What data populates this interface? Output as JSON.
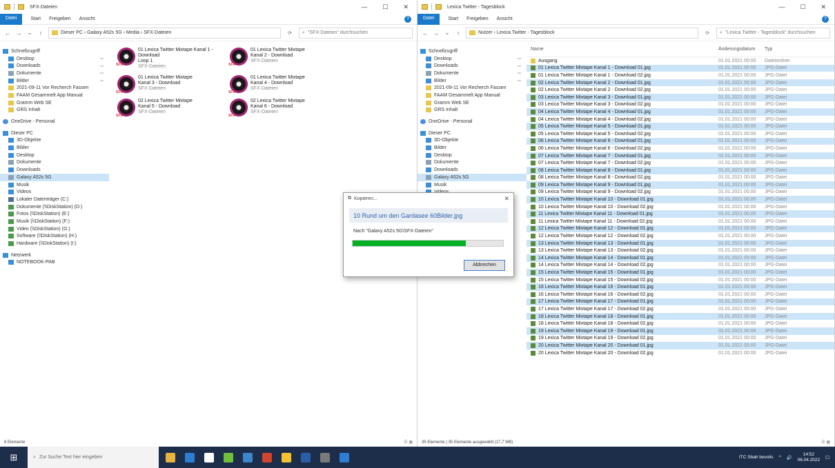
{
  "left": {
    "title": "SFX-Dateien",
    "ribbon_tabs": [
      "Datei",
      "Start",
      "Freigeben",
      "Ansicht"
    ],
    "address": "Dieser PC  ›  Galaxy A52s 5G  ›  Media  ›  SFX-Dateien",
    "search_placeholder": "\"SFX-Dateien\" durchsuchen",
    "status": "6 Elemente",
    "tiles": [
      {
        "name": "01 Lexica Twitter Mixtape Kanal 1 - Download",
        "name2": "Loop 1",
        "type": "SFX-Dateien"
      },
      {
        "name": "01 Lexica Twitter Mixtape",
        "name2": "Kanal 2 - Download",
        "type": "SFX-Dateien"
      },
      {
        "name": "01 Lexica Twitter Mixtape",
        "name2": "Kanal 3 - Download",
        "type": "SFX-Dateien"
      },
      {
        "name": "01 Lexica Twitter Mixtape",
        "name2": "Kanal 4 - Download",
        "type": "SFX-Dateien"
      },
      {
        "name": "02 Lexica Twitter Mixtape",
        "name2": "Kanal 5 - Download",
        "type": "SFX-Dateien"
      },
      {
        "name": "02 Lexica Twitter Mixtape",
        "name2": "Kanal 6 - Download",
        "type": "SFX-Dateien"
      }
    ]
  },
  "right": {
    "title": "Lexica Twitter - Tagesblock",
    "ribbon_tabs": [
      "Datei",
      "Start",
      "Freigeben",
      "Ansicht"
    ],
    "address": "Nutzer  ›  Lexica Twitter - Tagesblock",
    "search_placeholder": "\"Lexica Twitter - Tagesblock\" durchsuchen",
    "status": "35 Elemente  |  35 Elemente ausgewählt (17,7 MB)",
    "col_name": "Name",
    "col_date": "Änderungsdatum",
    "col_type": "Typ",
    "rows": [
      {
        "name": "Ausgang",
        "date": "01.01.2021 00:00",
        "type": "Dateiordner",
        "folder": true,
        "sel": false
      },
      {
        "name": "01 Lexica Twitter Mixtape Kanal 1 - Download 01.jpg",
        "date": "01.01.2021 00:00",
        "type": "JPG-Datei",
        "sel": true
      },
      {
        "name": "01 Lexica Twitter Mixtape Kanal 1 - Download 02.jpg",
        "date": "01.01.2021 00:00",
        "type": "JPG-Datei",
        "sel": false
      },
      {
        "name": "02 Lexica Twitter Mixtape Kanal 2 - Download 01.jpg",
        "date": "01.01.2021 00:00",
        "type": "JPG-Datei",
        "sel": true
      },
      {
        "name": "02 Lexica Twitter Mixtape Kanal 2 - Download 02.jpg",
        "date": "01.01.2021 00:00",
        "type": "JPG-Datei",
        "sel": false
      },
      {
        "name": "03 Lexica Twitter Mixtape Kanal 3 - Download 01.jpg",
        "date": "01.01.2021 00:00",
        "type": "JPG-Datei",
        "sel": true
      },
      {
        "name": "03 Lexica Twitter Mixtape Kanal 3 - Download 02.jpg",
        "date": "01.01.2021 00:00",
        "type": "JPG-Datei",
        "sel": false
      },
      {
        "name": "04 Lexica Twitter Mixtape Kanal 4 - Download 01.jpg",
        "date": "01.01.2021 00:00",
        "type": "JPG-Datei",
        "sel": true
      },
      {
        "name": "04 Lexica Twitter Mixtape Kanal 4 - Download 02.jpg",
        "date": "01.01.2021 00:00",
        "type": "JPG-Datei",
        "sel": false
      },
      {
        "name": "05 Lexica Twitter Mixtape Kanal 5 - Download 01.jpg",
        "date": "01.01.2021 00:00",
        "type": "JPG-Datei",
        "sel": true
      },
      {
        "name": "05 Lexica Twitter Mixtape Kanal 5 - Download 02.jpg",
        "date": "01.01.2021 00:00",
        "type": "JPG-Datei",
        "sel": false
      },
      {
        "name": "06 Lexica Twitter Mixtape Kanal 6 - Download 01.jpg",
        "date": "01.01.2021 00:00",
        "type": "JPG-Datei",
        "sel": true
      },
      {
        "name": "06 Lexica Twitter Mixtape Kanal 6 - Download 02.jpg",
        "date": "01.01.2021 00:00",
        "type": "JPG-Datei",
        "sel": false
      },
      {
        "name": "07 Lexica Twitter Mixtape Kanal 7 - Download 01.jpg",
        "date": "01.01.2021 00:00",
        "type": "JPG-Datei",
        "sel": true
      },
      {
        "name": "07 Lexica Twitter Mixtape Kanal 7 - Download 02.jpg",
        "date": "01.01.2021 00:00",
        "type": "JPG-Datei",
        "sel": false
      },
      {
        "name": "08 Lexica Twitter Mixtape Kanal 8 - Download 01.jpg",
        "date": "01.01.2021 00:00",
        "type": "JPG-Datei",
        "sel": true
      },
      {
        "name": "08 Lexica Twitter Mixtape Kanal 8 - Download 02.jpg",
        "date": "01.01.2021 00:00",
        "type": "JPG-Datei",
        "sel": false
      },
      {
        "name": "09 Lexica Twitter Mixtape Kanal 9 - Download 01.jpg",
        "date": "01.01.2021 00:00",
        "type": "JPG-Datei",
        "sel": true
      },
      {
        "name": "09 Lexica Twitter Mixtape Kanal 9 - Download 02.jpg",
        "date": "01.01.2021 00:00",
        "type": "JPG-Datei",
        "sel": false
      },
      {
        "name": "10 Lexica Twitter Mixtape Kanal 10 - Download 01.jpg",
        "date": "01.01.2021 00:00",
        "type": "JPG-Datei",
        "sel": true
      },
      {
        "name": "10 Lexica Twitter Mixtape Kanal 10 - Download 02.jpg",
        "date": "01.01.2021 00:00",
        "type": "JPG-Datei",
        "sel": false
      },
      {
        "name": "11 Lexica Twitter Mixtape Kanal 11 - Download 01.jpg",
        "date": "01.01.2021 00:00",
        "type": "JPG-Datei",
        "sel": true
      },
      {
        "name": "11 Lexica Twitter Mixtape Kanal 11 - Download 02.jpg",
        "date": "01.01.2021 00:00",
        "type": "JPG-Datei",
        "sel": false
      },
      {
        "name": "12 Lexica Twitter Mixtape Kanal 12 - Download 01.jpg",
        "date": "01.01.2021 00:00",
        "type": "JPG-Datei",
        "sel": true
      },
      {
        "name": "12 Lexica Twitter Mixtape Kanal 12 - Download 02.jpg",
        "date": "01.01.2021 00:00",
        "type": "JPG-Datei",
        "sel": false
      },
      {
        "name": "13 Lexica Twitter Mixtape Kanal 13 - Download 01.jpg",
        "date": "01.01.2021 00:00",
        "type": "JPG-Datei",
        "sel": true
      },
      {
        "name": "13 Lexica Twitter Mixtape Kanal 13 - Download 02.jpg",
        "date": "01.01.2021 00:00",
        "type": "JPG-Datei",
        "sel": false
      },
      {
        "name": "14 Lexica Twitter Mixtape Kanal 14 - Download 01.jpg",
        "date": "01.01.2021 00:00",
        "type": "JPG-Datei",
        "sel": true
      },
      {
        "name": "14 Lexica Twitter Mixtape Kanal 14 - Download 02.jpg",
        "date": "01.01.2021 00:00",
        "type": "JPG-Datei",
        "sel": false
      },
      {
        "name": "15 Lexica Twitter Mixtape Kanal 15 - Download 01.jpg",
        "date": "01.01.2021 00:00",
        "type": "JPG-Datei",
        "sel": true
      },
      {
        "name": "15 Lexica Twitter Mixtape Kanal 15 - Download 02.jpg",
        "date": "01.01.2021 00:00",
        "type": "JPG-Datei",
        "sel": false
      },
      {
        "name": "16 Lexica Twitter Mixtape Kanal 16 - Download 01.jpg",
        "date": "01.01.2021 00:00",
        "type": "JPG-Datei",
        "sel": true
      },
      {
        "name": "16 Lexica Twitter Mixtape Kanal 16 - Download 02.jpg",
        "date": "01.01.2021 00:00",
        "type": "JPG-Datei",
        "sel": false
      },
      {
        "name": "17 Lexica Twitter Mixtape Kanal 17 - Download 01.jpg",
        "date": "01.01.2021 00:00",
        "type": "JPG-Datei",
        "sel": true
      },
      {
        "name": "17 Lexica Twitter Mixtape Kanal 17 - Download 02.jpg",
        "date": "01.01.2021 00:00",
        "type": "JPG-Datei",
        "sel": false
      },
      {
        "name": "18 Lexica Twitter Mixtape Kanal 18 - Download 01.jpg",
        "date": "01.01.2021 00:00",
        "type": "JPG-Datei",
        "sel": true
      },
      {
        "name": "18 Lexica Twitter Mixtape Kanal 18 - Download 02.jpg",
        "date": "01.01.2021 00:00",
        "type": "JPG-Datei",
        "sel": false
      },
      {
        "name": "19 Lexica Twitter Mixtape Kanal 19 - Download 01.jpg",
        "date": "01.01.2021 00:00",
        "type": "JPG-Datei",
        "sel": true
      },
      {
        "name": "19 Lexica Twitter Mixtape Kanal 19 - Download 02.jpg",
        "date": "01.01.2021 00:00",
        "type": "JPG-Datei",
        "sel": false
      },
      {
        "name": "20 Lexica Twitter Mixtape Kanal 20 - Download 01.jpg",
        "date": "01.01.2021 00:00",
        "type": "JPG-Datei",
        "sel": true
      },
      {
        "name": "20 Lexica Twitter Mixtape Kanal 20 - Download 02.jpg",
        "date": "01.01.2021 00:00",
        "type": "JPG-Datei",
        "sel": false
      }
    ]
  },
  "nav": [
    {
      "label": "Schnellzugriff",
      "icon": "star-icon",
      "cls": "blue",
      "top": true
    },
    {
      "label": "Desktop",
      "icon": "desktop-icon",
      "cls": "blue",
      "pin": true
    },
    {
      "label": "Downloads",
      "icon": "download-icon",
      "cls": "blue",
      "pin": true
    },
    {
      "label": "Dokumente",
      "icon": "document-icon",
      "cls": "gray",
      "pin": true
    },
    {
      "label": "Bilder",
      "icon": "picture-icon",
      "cls": "blue",
      "pin": true
    },
    {
      "label": "2021-09-11 Vor Recherch Fassen",
      "icon": "folder-icon",
      "cls": "yellow"
    },
    {
      "label": "FAAM Gesammelt App Manual",
      "icon": "folder-icon",
      "cls": "yellow"
    },
    {
      "label": "Gramm Web SE",
      "icon": "folder-icon",
      "cls": "yellow"
    },
    {
      "label": "GRS Inhalt",
      "icon": "folder-icon",
      "cls": "yellow"
    },
    {
      "gap": true
    },
    {
      "label": "OneDrive - Personal",
      "icon": "cloud-icon",
      "cls": "cloud",
      "top": true
    },
    {
      "gap": true
    },
    {
      "label": "Dieser PC",
      "icon": "pc-icon",
      "cls": "blue",
      "top": true
    },
    {
      "label": "3D-Objekte",
      "icon": "cube-icon",
      "cls": "blue"
    },
    {
      "label": "Bilder",
      "icon": "picture-icon",
      "cls": "blue"
    },
    {
      "label": "Desktop",
      "icon": "desktop-icon",
      "cls": "blue"
    },
    {
      "label": "Dokumente",
      "icon": "document-icon",
      "cls": "gray"
    },
    {
      "label": "Downloads",
      "icon": "download-icon",
      "cls": "blue"
    },
    {
      "label": "Galaxy A52s 5G",
      "icon": "phone-icon",
      "cls": "gray",
      "selected": true
    },
    {
      "label": "Musik",
      "icon": "music-icon",
      "cls": "blue"
    },
    {
      "label": "Videos",
      "icon": "video-icon",
      "cls": "blue"
    },
    {
      "label": "Lokaler Datenträger (C:)",
      "icon": "drive-icon",
      "cls": "drive"
    },
    {
      "label": "Dokumente (\\\\DiskStation) (D:)",
      "icon": "network-drive-icon",
      "cls": "green"
    },
    {
      "label": "Fotos (\\\\DiskStation) (E:)",
      "icon": "network-drive-icon",
      "cls": "green"
    },
    {
      "label": "Musik (\\\\DiskStation) (F:)",
      "icon": "network-drive-icon",
      "cls": "green"
    },
    {
      "label": "Video (\\\\DiskStation) (G:)",
      "icon": "network-drive-icon",
      "cls": "green"
    },
    {
      "label": "Software (\\\\DiskStation) (H:)",
      "icon": "network-drive-icon",
      "cls": "green"
    },
    {
      "label": "Hardware (\\\\DiskStation) (I:)",
      "icon": "network-drive-icon",
      "cls": "green"
    },
    {
      "gap": true
    },
    {
      "label": "Netzwerk",
      "icon": "network-icon",
      "cls": "blue",
      "top": true
    },
    {
      "label": "NOTEBOOK-PAB",
      "icon": "computer-icon",
      "cls": "blue"
    }
  ],
  "dialog": {
    "title": "Kopieren...",
    "heading": "10 Rund um den Gardasee 60Bilder.jpg",
    "subtitle": "Nach \"Galaxy A52s 5G\\SFX-Dateien\"",
    "progress": 0.75,
    "cancel": "Abbrechen"
  },
  "taskbar": {
    "search_placeholder": "Zur Suche Text hier eingeben",
    "network_label": "ITC Sbah bevolis",
    "time": "14:52",
    "date": "06.04.2022",
    "apps": [
      "#e9b23c",
      "#2d7dd2",
      "#ffffff",
      "#6fbf3b",
      "#3a86c8",
      "#d2452c",
      "#f5c12e",
      "#2a5fa8",
      "#7a7a7a",
      "#2d7dd2"
    ]
  }
}
